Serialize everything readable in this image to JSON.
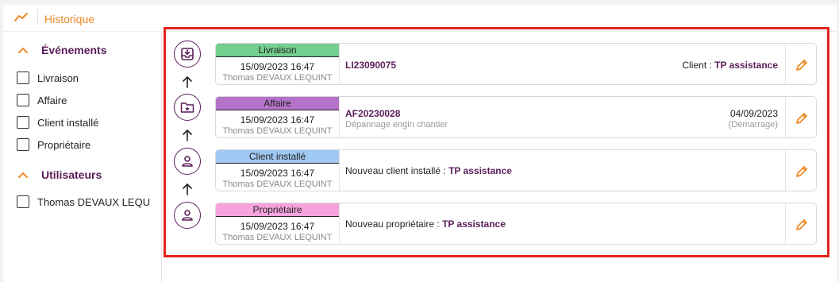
{
  "header": {
    "title": "Historique",
    "icon": "chart-line-icon",
    "accent": "#f08a28"
  },
  "sidebar": {
    "events_title": "Événements",
    "events": [
      {
        "label": "Livraison",
        "checked": false
      },
      {
        "label": "Affaire",
        "checked": false
      },
      {
        "label": "Client installé",
        "checked": false
      },
      {
        "label": "Propriétaire",
        "checked": false
      }
    ],
    "users_title": "Utilisateurs",
    "users": [
      {
        "label": "Thomas DEVAUX LEQU",
        "checked": false
      }
    ]
  },
  "events": [
    {
      "type": "Livraison",
      "tag_color": "#72cf8e",
      "icon": "inbox-download-icon",
      "date": "15/09/2023 16:47",
      "user": "Thomas DEVAUX LEQUINT",
      "reference": "LI23090075",
      "client_label": "Client :",
      "client_name": "TP assistance"
    },
    {
      "type": "Affaire",
      "tag_color": "#b473c9",
      "icon": "folder-star-icon",
      "date": "15/09/2023 16:47",
      "user": "Thomas DEVAUX LEQUINT",
      "reference": "AF20230028",
      "description": "Dépannage engin chantier",
      "start_date": "04/09/2023",
      "start_label": "(Démarrage)"
    },
    {
      "type": "Client installé",
      "tag_color": "#9fc8f2",
      "icon": "user-icon",
      "date": "15/09/2023 16:47",
      "user": "Thomas DEVAUX LEQUINT",
      "message": "Nouveau client installé :",
      "client_name": "TP assistance"
    },
    {
      "type": "Propriétaire",
      "tag_color": "#f7a3de",
      "icon": "user-icon",
      "date": "15/09/2023 16:47",
      "user": "Thomas DEVAUX LEQUINT",
      "message": "Nouveau propriétaire :",
      "client_name": "TP assistance"
    }
  ]
}
